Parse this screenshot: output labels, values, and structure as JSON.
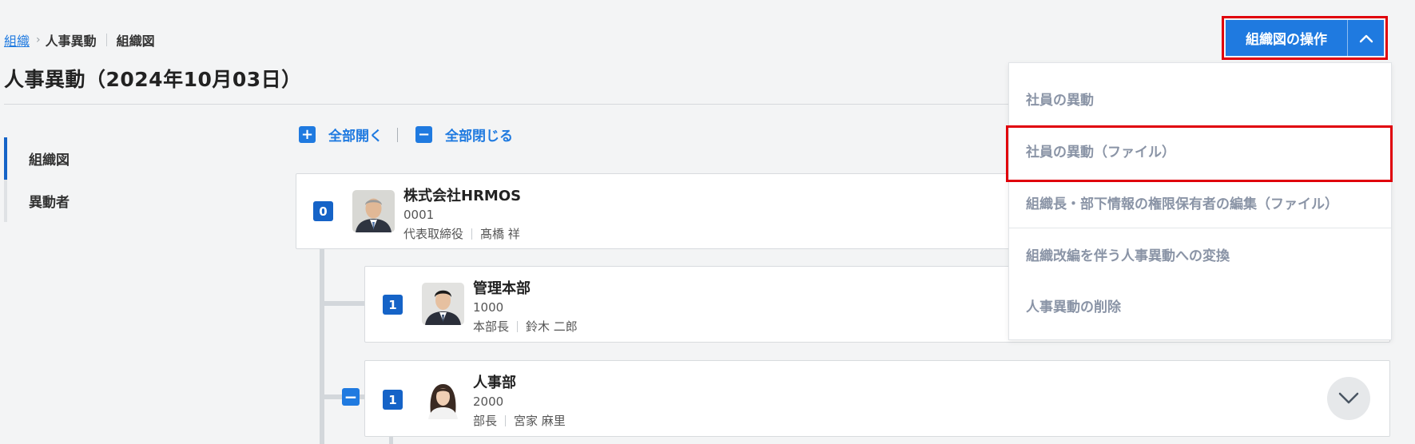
{
  "breadcrumb": {
    "root_link": "組織",
    "current": "人事異動",
    "sub": "組織図"
  },
  "page_title": "人事異動（2024年10月03日）",
  "sidenav": {
    "items": [
      {
        "label": "組織図",
        "active": true
      },
      {
        "label": "異動者",
        "active": false
      }
    ]
  },
  "tree_controls": {
    "expand_all": "全部開く",
    "collapse_all": "全部閉じる"
  },
  "org_tree": [
    {
      "level": "0",
      "name": "株式会社HRMOS",
      "code": "0001",
      "role": "代表取締役",
      "person": "髙橋 祥"
    },
    {
      "level": "1",
      "name": "管理本部",
      "code": "1000",
      "role": "本部長",
      "person": "鈴木 二郎"
    },
    {
      "level": "1",
      "name": "人事部",
      "code": "2000",
      "role": "部長",
      "person": "宮家 麻里"
    }
  ],
  "action_menu": {
    "button_label": "組織図の操作",
    "items": [
      "社員の異動",
      "社員の異動（ファイル）",
      "組織長・部下情報の権限保有者の編集（ファイル）",
      "組織改編を伴う人事異動への変換",
      "人事異動の削除"
    ]
  },
  "colors": {
    "accent": "#1f7ae0",
    "badge": "#1563c7",
    "highlight": "#e0000a",
    "menu_text": "#8a94a6"
  }
}
